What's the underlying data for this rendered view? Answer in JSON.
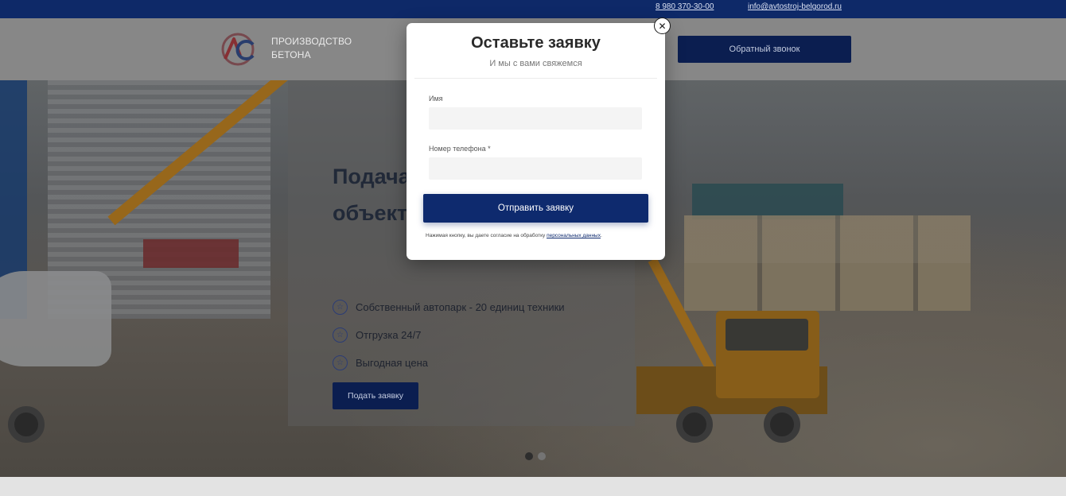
{
  "topbar": {
    "phone": "8 980 370-30-00",
    "email": "info@avtostroj-belgorod.ru"
  },
  "header": {
    "logo_line1": "ПРОИЗВОДСТВО",
    "logo_line2": "БЕТОНА",
    "logo_icon": "ac-logo-icon",
    "callback_label": "Обратный звонок"
  },
  "hero": {
    "title": "Подача бетона на любой объект",
    "features": [
      "Собственный автопарк - 20 единиц техники",
      "Отгрузка 24/7",
      "Выгодная цена"
    ],
    "feature_icon": "star-circle-icon",
    "button_label": "Подать заявку",
    "slides_count": 2,
    "active_slide": 1
  },
  "modal": {
    "title": "Оставьте заявку",
    "subtitle": "И мы с вами свяжемся",
    "name_label": "Имя",
    "name_value": "",
    "phone_label": "Номер телефона *",
    "phone_value": "",
    "submit_label": "Отправить заявку",
    "consent_text": "Нажимая кнопку, вы даете согласие на обработку ",
    "consent_link": "персональных данных",
    "consent_end": ".",
    "close_icon": "close-icon"
  },
  "colors": {
    "brand_dark": "#0f2a6b",
    "button": "#0e2a6e",
    "logo_red": "#d6262d",
    "logo_blue": "#1f3f8f"
  }
}
